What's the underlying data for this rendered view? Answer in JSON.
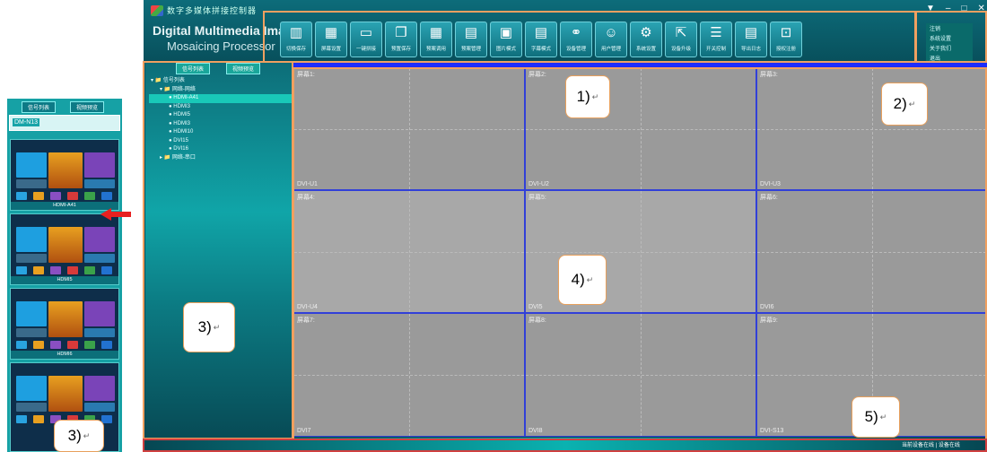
{
  "window": {
    "title": "数字多媒体拼接控制器",
    "brand_line1": "Digital Multimedia Image",
    "brand_line2": "Mosaicing Processor"
  },
  "toolbar": [
    {
      "icon": "books-icon",
      "glyph": "▥",
      "label": "切换保存"
    },
    {
      "icon": "network-icon",
      "glyph": "▦",
      "label": "屏幕设置"
    },
    {
      "icon": "monitor-icon",
      "glyph": "▭",
      "label": "一键拼接"
    },
    {
      "icon": "window-icon",
      "glyph": "❐",
      "label": "预置保存"
    },
    {
      "icon": "grid-icon",
      "glyph": "▦",
      "label": "预案调用"
    },
    {
      "icon": "grid-gear-icon",
      "glyph": "▤",
      "label": "预案管理"
    },
    {
      "icon": "image-icon",
      "glyph": "▣",
      "label": "图片模式"
    },
    {
      "icon": "document-icon",
      "glyph": "▤",
      "label": "字幕模式"
    },
    {
      "icon": "link-icon",
      "glyph": "⚭",
      "label": "设备管理"
    },
    {
      "icon": "users-icon",
      "glyph": "☺",
      "label": "用户管理"
    },
    {
      "icon": "gears-icon",
      "glyph": "⚙",
      "label": "系统设置"
    },
    {
      "icon": "export-icon",
      "glyph": "⇱",
      "label": "设备升级"
    },
    {
      "icon": "switch-icon",
      "glyph": "☰",
      "label": "开关控制"
    },
    {
      "icon": "log-icon",
      "glyph": "▤",
      "label": "导出日志"
    },
    {
      "icon": "lock-icon",
      "glyph": "⊡",
      "label": "授权注册"
    }
  ],
  "menu": [
    "注销",
    "系统设置",
    "关于我们",
    "退出"
  ],
  "sidebar": {
    "tabs": [
      "信号列表",
      "视频预览"
    ],
    "tree": [
      {
        "text": "▾ 📁 信号列表",
        "indent": 0,
        "selected": false
      },
      {
        "text": "▾ 📁 网络-网络",
        "indent": 1,
        "selected": false
      },
      {
        "text": "● HDMI-A41",
        "indent": 2,
        "selected": true
      },
      {
        "text": "● HDMI3",
        "indent": 2,
        "selected": false
      },
      {
        "text": "● HDMI5",
        "indent": 2,
        "selected": false
      },
      {
        "text": "● HDMI3",
        "indent": 2,
        "selected": false
      },
      {
        "text": "● HDMI10",
        "indent": 2,
        "selected": false
      },
      {
        "text": "● DVI15",
        "indent": 2,
        "selected": false
      },
      {
        "text": "● DVI16",
        "indent": 2,
        "selected": false
      },
      {
        "text": "▸ 📁 网络-串口",
        "indent": 1,
        "selected": false
      }
    ]
  },
  "screens": [
    {
      "top": "屏幕1:",
      "bottom": "DVI-U1"
    },
    {
      "top": "屏幕2:",
      "bottom": "DVI-U2"
    },
    {
      "top": "屏幕3:",
      "bottom": "DVI-U3"
    },
    {
      "top": "屏幕4:",
      "bottom": "DVI-U4"
    },
    {
      "top": "屏幕5:",
      "bottom": "DVI5"
    },
    {
      "top": "屏幕6:",
      "bottom": "DVI6"
    },
    {
      "top": "屏幕7:",
      "bottom": "DVI7"
    },
    {
      "top": "屏幕8:",
      "bottom": "DVI8"
    },
    {
      "top": "屏幕9:",
      "bottom": "DVI-S13"
    }
  ],
  "status": "当前设备在线 | 设备在线",
  "thumbpanel": {
    "tabs": [
      "信号列表",
      "视频预览"
    ],
    "header": "DM-N13",
    "captions": [
      "HDMI-A41",
      "HDMI5",
      "HDMI6",
      ""
    ]
  },
  "callouts": [
    "1)",
    "2)",
    "3)",
    "4)",
    "5)",
    "3)"
  ],
  "colors": {
    "frame": "#f0a060",
    "grid_border": "#3140d8",
    "bluebar": "#1e2cff"
  }
}
